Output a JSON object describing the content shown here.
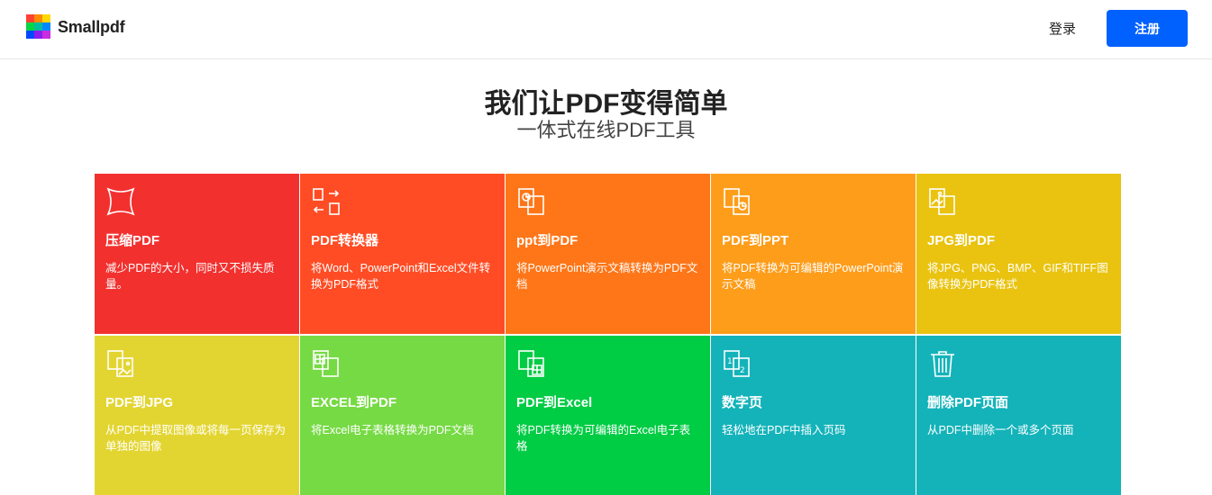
{
  "header": {
    "brand": "Smallpdf",
    "login_label": "登录",
    "signup_label": "注册",
    "logo_colors": [
      "#ff4133",
      "#ff8b03",
      "#ffd800",
      "#05d643",
      "#00bd9f",
      "#0088ff",
      "#0048ff",
      "#8b1dee",
      "#c72ee0"
    ]
  },
  "hero": {
    "title": "我们让PDF变得简单",
    "subtitle": "一体式在线PDF工具"
  },
  "tools": [
    {
      "title": "压缩PDF",
      "desc": "减少PDF的大小，同时又不损失质量。",
      "color": "#f2312f",
      "icon": "compress-icon"
    },
    {
      "title": "PDF转换器",
      "desc": "将Word、PowerPoint和Excel文件转换为PDF格式",
      "color": "#ff4c24",
      "icon": "convert-icon"
    },
    {
      "title": "ppt到PDF",
      "desc": "将PowerPoint演示文稿转换为PDF文档",
      "color": "#fe7618",
      "icon": "ppt-to-pdf-icon"
    },
    {
      "title": "PDF到PPT",
      "desc": "将PDF转换为可编辑的PowerPoint演示文稿",
      "color": "#fe9d1a",
      "icon": "pdf-to-ppt-icon"
    },
    {
      "title": "JPG到PDF",
      "desc": "将JPG、PNG、BMP、GIF和TIFF图像转换为PDF格式",
      "color": "#e9c30f",
      "icon": "jpg-to-pdf-icon"
    },
    {
      "title": "PDF到JPG",
      "desc": "从PDF中提取图像或将每一页保存为单独的图像",
      "color": "#e3d531",
      "icon": "pdf-to-jpg-icon"
    },
    {
      "title": "EXCEL到PDF",
      "desc": "将Excel电子表格转换为PDF文档",
      "color": "#76da44",
      "icon": "excel-to-pdf-icon"
    },
    {
      "title": "PDF到Excel",
      "desc": "将PDF转换为可编辑的Excel电子表格",
      "color": "#00cc44",
      "icon": "pdf-to-excel-icon"
    },
    {
      "title": "数字页",
      "desc": "轻松地在PDF中插入页码",
      "color": "#14b3ba",
      "icon": "page-numbers-icon"
    },
    {
      "title": "删除PDF页面",
      "desc": "从PDF中删除一个或多个页面",
      "color": "#14b3ba",
      "icon": "trash-icon"
    }
  ]
}
